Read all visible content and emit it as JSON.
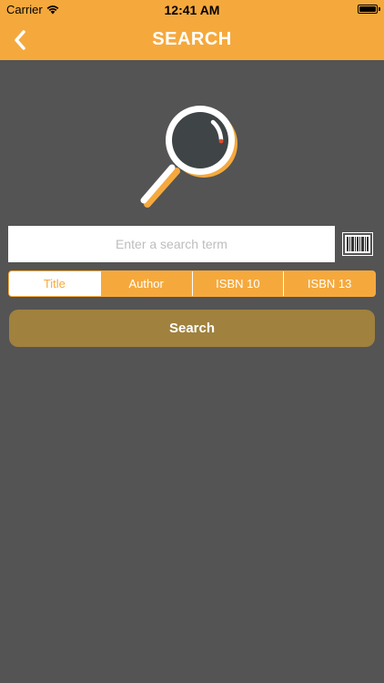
{
  "status_bar": {
    "carrier": "Carrier",
    "time": "12:41 AM",
    "battery_level": 1.0
  },
  "nav": {
    "title": "SEARCH",
    "back_icon": "chevron-left-icon"
  },
  "hero": {
    "icon": "magnifying-glass-icon"
  },
  "search": {
    "placeholder": "Enter a search term",
    "value": "",
    "barcode_icon": "barcode-icon"
  },
  "segments": {
    "selected": "Title",
    "items": [
      {
        "label": "Title"
      },
      {
        "label": "Author"
      },
      {
        "label": "ISBN 10"
      },
      {
        "label": "ISBN 13"
      }
    ]
  },
  "actions": {
    "search_label": "Search"
  },
  "colors": {
    "accent": "#F5A93D",
    "background": "#545454",
    "button": "#A0813E",
    "white": "#FFFFFF"
  }
}
